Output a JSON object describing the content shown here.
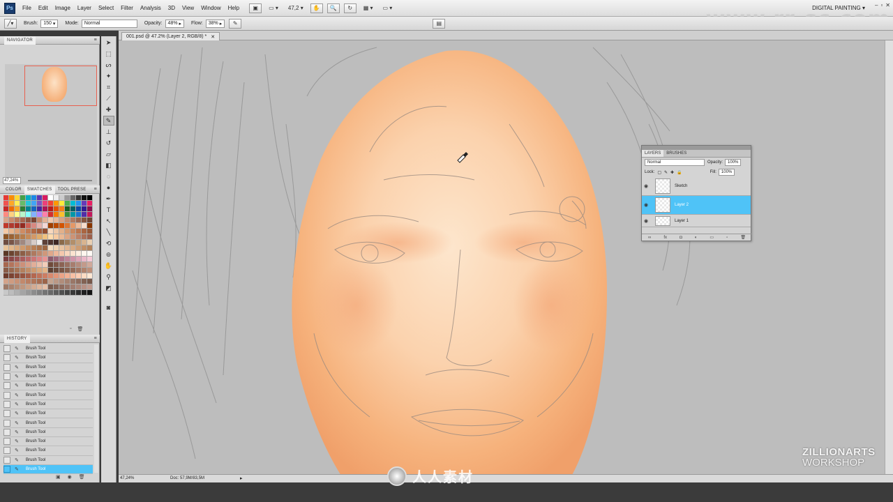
{
  "app": {
    "logo": "Ps",
    "menu": [
      "File",
      "Edit",
      "Image",
      "Layer",
      "Select",
      "Filter",
      "Analysis",
      "3D",
      "View",
      "Window",
      "Help"
    ],
    "zoom_dropdown": "47,2",
    "workspace": "DIGITAL PAINTING",
    "window_controls": [
      "–",
      "▫",
      "✕"
    ]
  },
  "watermark_top": "www.rr-sc.com",
  "options": {
    "brush_label": "Brush:",
    "brush_size": "150",
    "mode_label": "Mode:",
    "mode_value": "Normal",
    "opacity_label": "Opacity:",
    "opacity_value": "48%",
    "flow_label": "Flow:",
    "flow_value": "38%"
  },
  "navigator": {
    "title": "NAVIGATOR",
    "zoom": "47,24%"
  },
  "swatches": {
    "tabs": [
      "COLOR",
      "SWATCHES",
      "TOOL PRESE"
    ],
    "colors": [
      "#e53935",
      "#fb8c00",
      "#fdd835",
      "#43a047",
      "#00acc1",
      "#1e88e5",
      "#5e35b1",
      "#d81b60",
      "#ffffff",
      "#eeeeee",
      "#cccccc",
      "#999999",
      "#666666",
      "#333333",
      "#111111",
      "#000000",
      "#ef5350",
      "#ffa726",
      "#ffee58",
      "#66bb6a",
      "#26c6da",
      "#42a5f5",
      "#7e57c2",
      "#ec407a",
      "#f44336",
      "#ff9800",
      "#ffeb3b",
      "#4caf50",
      "#00bcd4",
      "#2196f3",
      "#673ab7",
      "#e91e63",
      "#c62828",
      "#ef6c00",
      "#f9a825",
      "#2e7d32",
      "#00838f",
      "#1565c0",
      "#4527a0",
      "#ad1457",
      "#b71c1c",
      "#e65100",
      "#f57f17",
      "#1b5e20",
      "#006064",
      "#0d47a1",
      "#311b92",
      "#880e4f",
      "#ff8a80",
      "#ffd180",
      "#ffff8d",
      "#b9f6ca",
      "#84ffff",
      "#82b1ff",
      "#b388ff",
      "#ff80ab",
      "#d32f2f",
      "#f57c00",
      "#fbc02d",
      "#388e3c",
      "#0097a7",
      "#1976d2",
      "#512da8",
      "#c2185b",
      "#d7a48a",
      "#c98a6c",
      "#b8765a",
      "#a86650",
      "#8f5440",
      "#7a4434",
      "#c6886a",
      "#e2b296",
      "#f0c8ae",
      "#e6b89c",
      "#d8a284",
      "#c58d70",
      "#b07a60",
      "#9a6650",
      "#845540",
      "#6e4434",
      "#c0392b",
      "#b03a2e",
      "#a93226",
      "#922b21",
      "#cd6155",
      "#d98880",
      "#e6b0aa",
      "#f2d7d5",
      "#a04000",
      "#ba4a00",
      "#d35400",
      "#dc7633",
      "#e59866",
      "#edbb99",
      "#f6ddcc",
      "#873600",
      "#f3c9a5",
      "#e8b48c",
      "#dca077",
      "#cf8c63",
      "#c27a52",
      "#b46a44",
      "#a45c3a",
      "#934f31",
      "#f7d8be",
      "#eec7a6",
      "#e2b08a",
      "#d59a71",
      "#c9875d",
      "#ba754d",
      "#aa6541",
      "#985837",
      "#8d5524",
      "#9b6233",
      "#a9703f",
      "#b87d4b",
      "#c68b59",
      "#d49966",
      "#e0ac69",
      "#f1c27d",
      "#ffdbac",
      "#f6caa0",
      "#eab893",
      "#dca584",
      "#cd9375",
      "#bd8166",
      "#ad7058",
      "#9c604b",
      "#6d4c41",
      "#795548",
      "#8d6e63",
      "#a1887f",
      "#bcaaa4",
      "#d7ccc8",
      "#efebe9",
      "#5d4037",
      "#4e342e",
      "#3e2723",
      "#8b6b4a",
      "#9f7d59",
      "#b38f6a",
      "#c7a27c",
      "#d9b48f",
      "#ead0b2",
      "#e7c39a",
      "#e1b68a",
      "#d9a87b",
      "#cf9a6d",
      "#c48c60",
      "#b87f55",
      "#aa724b",
      "#9c6642",
      "#f4dcc0",
      "#efd0b0",
      "#e8c3a0",
      "#e0b690",
      "#d7a981",
      "#cc9c73",
      "#c08f66",
      "#b3825a",
      "#5a3825",
      "#6b4430",
      "#7c513b",
      "#8d5e46",
      "#9e6b52",
      "#af795f",
      "#c0886c",
      "#d0977a",
      "#e0a78a",
      "#efb89b",
      "#f5c7ac",
      "#f9d6be",
      "#fbe3cf",
      "#fdeee0",
      "#fff6ee",
      "#fffaf5",
      "#7b3f3f",
      "#8a4848",
      "#9a5252",
      "#aa5d5d",
      "#bb6969",
      "#cc7676",
      "#dc8484",
      "#e99494",
      "#8c5a6b",
      "#9d6779",
      "#ae7588",
      "#bf8497",
      "#cf94a7",
      "#dea5b8",
      "#ebb7c8",
      "#f5c9d7",
      "#a7674f",
      "#b4745c",
      "#c1826a",
      "#cd9079",
      "#d89f89",
      "#e2ae99",
      "#ebbea9",
      "#f2cdb9",
      "#6f4a3a",
      "#7d5646",
      "#8b6253",
      "#996f60",
      "#a77d6e",
      "#b58b7c",
      "#c39a8b",
      "#d1a99a",
      "#8a5c48",
      "#98684f",
      "#a67456",
      "#b4805e",
      "#c18d67",
      "#ce9a71",
      "#d9a77c",
      "#e3b488",
      "#5c4033",
      "#6a4a3b",
      "#785444",
      "#865f4d",
      "#946a57",
      "#a27662",
      "#b0826d",
      "#be8f79",
      "#6e3b2c",
      "#7c4332",
      "#8a4b38",
      "#98543f",
      "#a65d47",
      "#b4674f",
      "#c17258",
      "#cd7d62",
      "#d8896d",
      "#e29679",
      "#eba386",
      "#f3b194",
      "#f8bfa3",
      "#fccdb3",
      "#fedbc3",
      "#ffe8d4",
      "#d3a38a",
      "#cf9b80",
      "#c99276",
      "#c2896c",
      "#ba7f62",
      "#b17659",
      "#a76d51",
      "#9c6449",
      "#c4a38f",
      "#bb9885",
      "#b18d7b",
      "#a68271",
      "#9a7767",
      "#8e6c5d",
      "#826253",
      "#76584a",
      "#9e7a68",
      "#a9836f",
      "#b48d77",
      "#bf977f",
      "#c9a188",
      "#d3ab92",
      "#dcb59c",
      "#e5bfa7",
      "#7a5c4f",
      "#846457",
      "#8e6c5f",
      "#987568",
      "#a27e71",
      "#ac877a",
      "#b69084",
      "#bf9a8e",
      "#c8c8c8",
      "#bdbdbd",
      "#b0b0b0",
      "#a4a4a4",
      "#989898",
      "#8c8c8c",
      "#808080",
      "#747474",
      "#686868",
      "#5c5c5c",
      "#505050",
      "#444444",
      "#383838",
      "#2c2c2c",
      "#202020",
      "#141414"
    ]
  },
  "history": {
    "title": "HISTORY",
    "items": [
      "Brush Tool",
      "Brush Tool",
      "Brush Tool",
      "Brush Tool",
      "Brush Tool",
      "Brush Tool",
      "Brush Tool",
      "Brush Tool",
      "Brush Tool",
      "Brush Tool",
      "Brush Tool",
      "Brush Tool",
      "Brush Tool",
      "Brush Tool"
    ],
    "active_index": 13
  },
  "document": {
    "tab_title": "001.psd @ 47.2% (Layer 2, RGB/8) *"
  },
  "status": {
    "zoom": "47,24%",
    "doc": "Doc: 57,9M/83,5M"
  },
  "layers": {
    "tabs": [
      "LAYERS",
      "BRUSHES"
    ],
    "blend_mode": "Normal",
    "opacity_label": "Opacity:",
    "opacity_value": "100%",
    "lock_label": "Lock:",
    "fill_label": "Fill:",
    "fill_value": "100%",
    "items": [
      {
        "name": "Sketch",
        "active": false
      },
      {
        "name": "Layer 2",
        "active": true
      },
      {
        "name": "Layer 1",
        "active": false
      }
    ]
  },
  "branding": {
    "line1": "ZILLIONARTS",
    "line2": "WORKSHOP",
    "site": "人人素材"
  },
  "colors": {
    "accent": "#4fc3f7",
    "skin": "#f5b07a",
    "canvas": "#bdbdbd"
  }
}
